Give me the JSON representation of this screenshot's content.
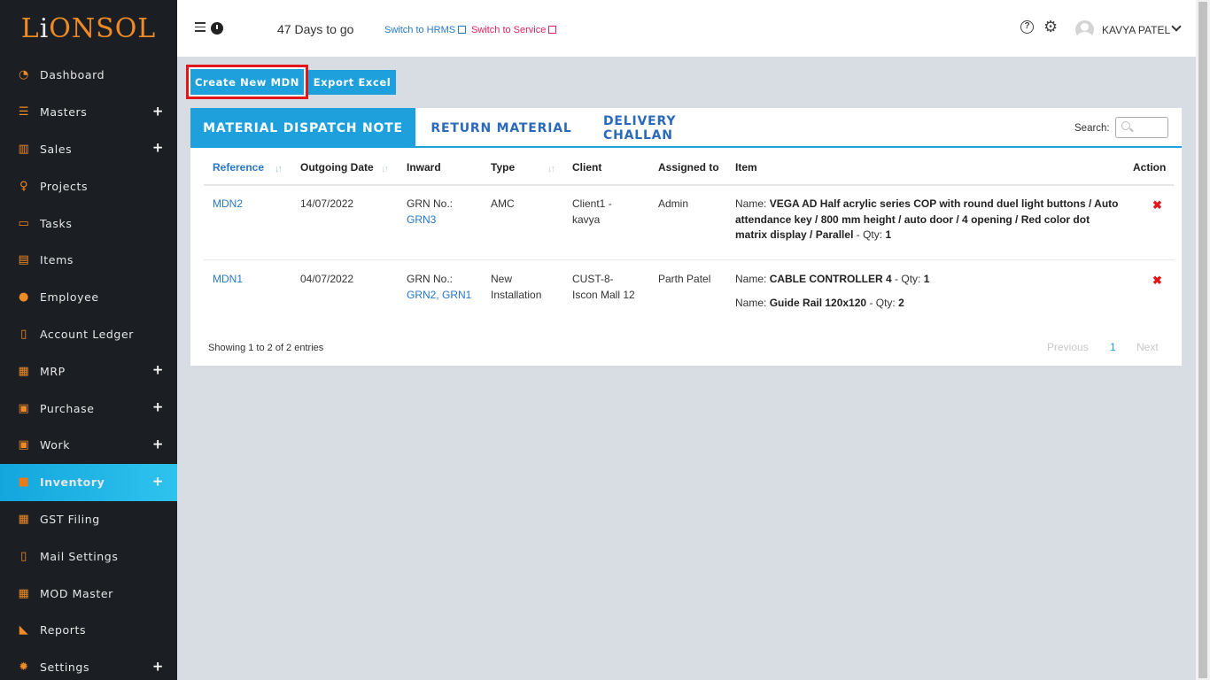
{
  "app": {
    "logo_text": "LIONSOL"
  },
  "sidebar": {
    "items": [
      {
        "label": "Dashboard",
        "icon": "dashboard-icon",
        "expandable": false
      },
      {
        "label": "Masters",
        "icon": "database-icon",
        "expandable": true
      },
      {
        "label": "Sales",
        "icon": "sales-chart-icon",
        "expandable": true
      },
      {
        "label": "Projects",
        "icon": "lightbulb-icon",
        "expandable": false
      },
      {
        "label": "Tasks",
        "icon": "inbox-icon",
        "expandable": false
      },
      {
        "label": "Items",
        "icon": "archive-icon",
        "expandable": false
      },
      {
        "label": "Employee",
        "icon": "user-icon",
        "expandable": false
      },
      {
        "label": "Account Ledger",
        "icon": "document-icon",
        "expandable": false
      },
      {
        "label": "MRP",
        "icon": "grid-icon",
        "expandable": true
      },
      {
        "label": "Purchase",
        "icon": "briefcase-icon",
        "expandable": true
      },
      {
        "label": "Work",
        "icon": "briefcase-icon",
        "expandable": true
      },
      {
        "label": "Inventory",
        "icon": "inventory-icon",
        "expandable": true,
        "active": true
      },
      {
        "label": "GST Filing",
        "icon": "calendar-icon",
        "expandable": false
      },
      {
        "label": "Mail Settings",
        "icon": "document-icon",
        "expandable": false
      },
      {
        "label": "MOD Master",
        "icon": "grid-icon",
        "expandable": false
      },
      {
        "label": "Reports",
        "icon": "area-chart-icon",
        "expandable": false
      },
      {
        "label": "Settings",
        "icon": "gear-icon",
        "expandable": true
      }
    ],
    "expand_symbol": "+"
  },
  "header": {
    "days_to_go": "47 Days to go",
    "switch_hrms": "Switch to HRMS",
    "switch_service": "Switch to Service",
    "help_symbol": "?",
    "settings_symbol": "⚙",
    "user_name": "KAVYA PATEL"
  },
  "toolbar": {
    "create_label": "Create New MDN",
    "export_label": "Export Excel"
  },
  "tabs": [
    {
      "label": "MATERIAL DISPATCH NOTE",
      "active": true
    },
    {
      "label": "RETURN MATERIAL",
      "active": false
    },
    {
      "label": "DELIVERY CHALLAN",
      "active": false
    }
  ],
  "search": {
    "label": "Search:",
    "value": ""
  },
  "table": {
    "columns": [
      "Reference",
      "Outgoing Date",
      "Inward",
      "Type",
      "Client",
      "Assigned to",
      "Item",
      "Action"
    ],
    "sort_symbol": "↓↑",
    "rows": [
      {
        "reference": "MDN2",
        "date": "14/07/2022",
        "inward_prefix": "GRN No.:",
        "inward_links": "GRN3",
        "type_line1": "AMC",
        "type_line2": "",
        "client_line1": "Client1 -",
        "client_line2": "kavya",
        "assigned": "Admin",
        "items": [
          {
            "name_label": "Name:",
            "name_line1": "VEGA AD Half acrylic series COP with round duel light buttons / Auto",
            "name_line2": "attendance key / 800 mm height / auto door / 4 opening / Red color dot",
            "name_line3": "matrix display / Parallel",
            "qty_label": "- Qty:",
            "qty": "1"
          }
        ],
        "action_symbol": "✖"
      },
      {
        "reference": "MDN1",
        "date": "04/07/2022",
        "inward_prefix": "GRN No.:",
        "inward_links": "GRN2, GRN1",
        "type_line1": "New",
        "type_line2": "Installation",
        "client_line1": "CUST-8-",
        "client_line2": "Iscon Mall 12",
        "assigned": "Parth Patel",
        "items": [
          {
            "name_label": "Name:",
            "name_line1": "CABLE CONTROLLER 4",
            "qty_label": "- Qty:",
            "qty": "1"
          },
          {
            "name_label": "Name:",
            "name_line1": "Guide Rail 120x120",
            "qty_label": "- Qty:",
            "qty": "2"
          }
        ],
        "action_symbol": "✖"
      }
    ]
  },
  "footer": {
    "info": "Showing 1 to 2 of 2 entries",
    "previous": "Previous",
    "page": "1",
    "next": "Next"
  },
  "colors": {
    "sidebar_bg": "#1b1f24",
    "accent": "#1ea0dc",
    "icon_orange": "#f08a24",
    "highlight_red": "#e3161c"
  }
}
